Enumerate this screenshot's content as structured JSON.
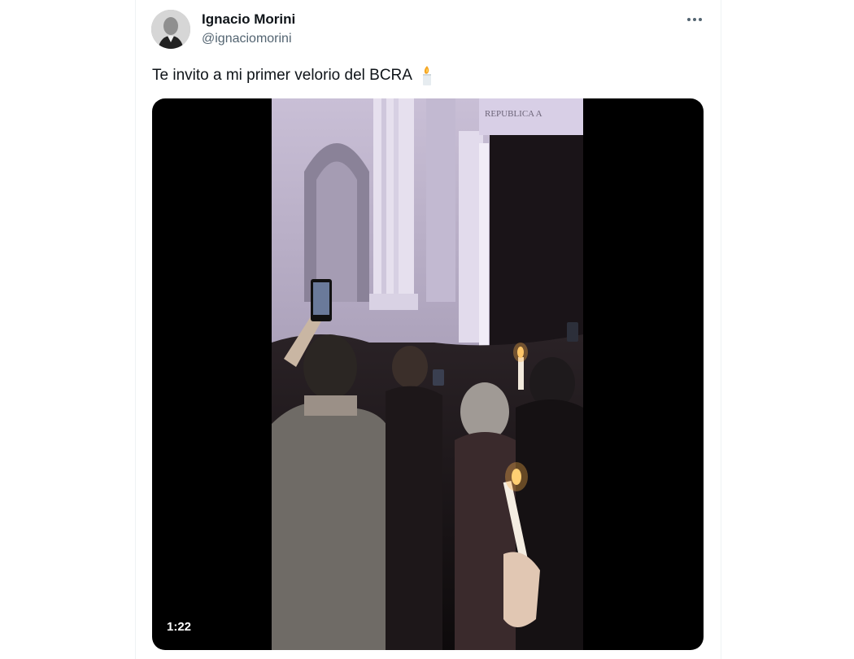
{
  "author": {
    "name": "Ignacio Morini",
    "handle": "@ignaciomorini"
  },
  "tweet": {
    "text": "Te invito a mi primer velorio del BCRA",
    "emoji": "candle-icon"
  },
  "media": {
    "type": "video",
    "duration": "1:22",
    "building_inscription": "REPUBLICA A"
  },
  "icons": {
    "more": "more-options-icon",
    "candle": "candle-icon"
  },
  "colors": {
    "text_primary": "#0f1419",
    "text_secondary": "#536471",
    "border": "#eff3f4"
  }
}
